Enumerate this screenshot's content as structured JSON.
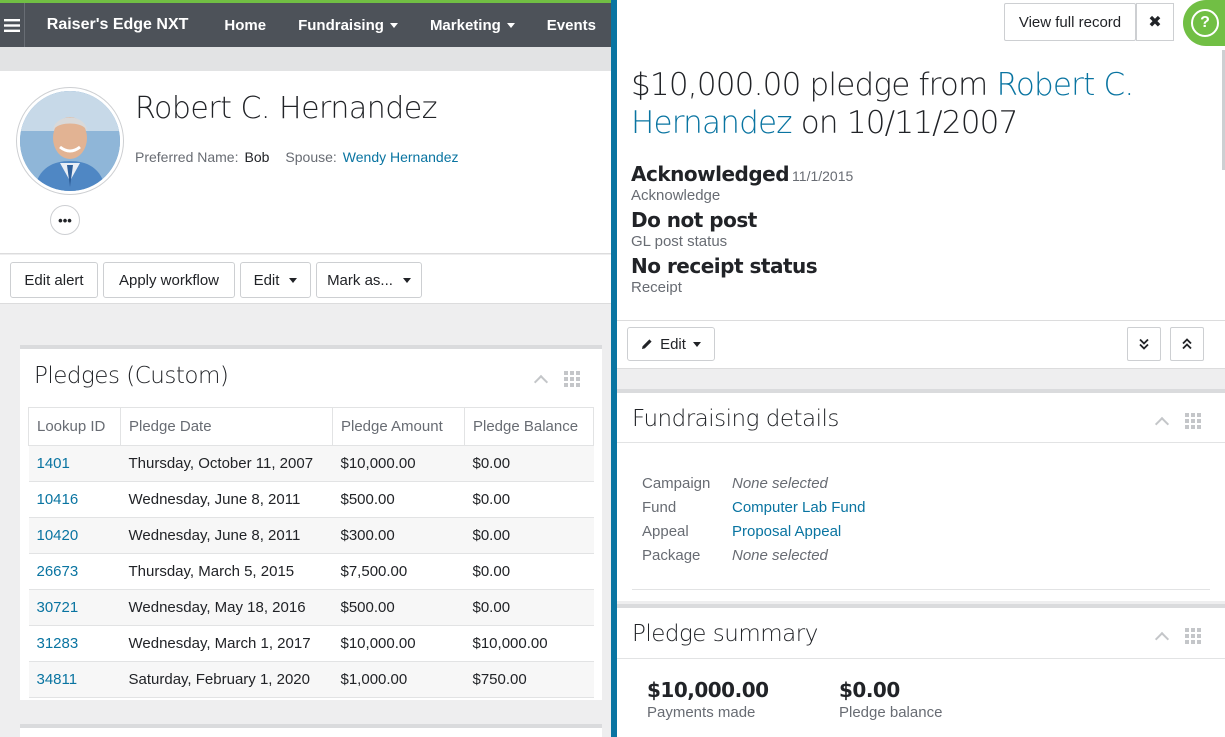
{
  "nav": {
    "brand": "Raiser's Edge NXT",
    "items": [
      {
        "label": "Home",
        "dropdown": false
      },
      {
        "label": "Fundraising",
        "dropdown": true
      },
      {
        "label": "Marketing",
        "dropdown": true
      },
      {
        "label": "Events",
        "dropdown": false
      }
    ]
  },
  "constituent": {
    "name": "Robert C. Hernandez",
    "preferred_label": "Preferred Name:",
    "preferred_value": "Bob",
    "spouse_label": "Spouse:",
    "spouse_value": "Wendy Hernandez",
    "more_label": "•••"
  },
  "actions": {
    "edit_alert": "Edit alert",
    "apply_workflow": "Apply workflow",
    "edit": "Edit",
    "mark_as": "Mark as..."
  },
  "pledges_tile": {
    "title": "Pledges (Custom)",
    "columns": [
      "Lookup ID",
      "Pledge Date",
      "Pledge Amount",
      "Pledge Balance"
    ],
    "rows": [
      [
        "1401",
        "Thursday, October 11, 2007",
        "$10,000.00",
        "$0.00"
      ],
      [
        "10416",
        "Wednesday, June 8, 2011",
        "$500.00",
        "$0.00"
      ],
      [
        "10420",
        "Wednesday, June 8, 2011",
        "$300.00",
        "$0.00"
      ],
      [
        "26673",
        "Thursday, March 5, 2015",
        "$7,500.00",
        "$0.00"
      ],
      [
        "30721",
        "Wednesday, May 18, 2016",
        "$500.00",
        "$0.00"
      ],
      [
        "31283",
        "Wednesday, March 1, 2017",
        "$10,000.00",
        "$10,000.00"
      ],
      [
        "34811",
        "Saturday, February 1, 2020",
        "$1,000.00",
        "$750.00"
      ]
    ]
  },
  "flyout": {
    "view_full_record": "View full record",
    "close_glyph": "✖",
    "help_glyph": "?",
    "headline_prefix": "$10,000.00 pledge from ",
    "headline_link": "Robert C. Hernandez",
    "headline_suffix": " on 10/11/2007",
    "statuses": [
      {
        "main": "Acknowledged",
        "date": "11/1/2015",
        "sub": "Acknowledge"
      },
      {
        "main": "Do not post",
        "date": "",
        "sub": "GL post status"
      },
      {
        "main": "No receipt status",
        "date": "",
        "sub": "Receipt"
      }
    ],
    "edit_label": "Edit",
    "fundraising": {
      "title": "Fundraising details",
      "rows": [
        {
          "label": "Campaign",
          "value": "None selected",
          "type": "none"
        },
        {
          "label": "Fund",
          "value": "Computer Lab Fund",
          "type": "link"
        },
        {
          "label": "Appeal",
          "value": "Proposal Appeal",
          "type": "link"
        },
        {
          "label": "Package",
          "value": "None selected",
          "type": "none"
        }
      ]
    },
    "summary": {
      "title": "Pledge summary",
      "items": [
        {
          "value": "$10,000.00",
          "label": "Payments made"
        },
        {
          "value": "$0.00",
          "label": "Pledge balance"
        }
      ]
    }
  },
  "colors": {
    "accent_blue": "#0974a1",
    "nav_bg": "#4d5259",
    "brand_green": "#71bf44"
  }
}
